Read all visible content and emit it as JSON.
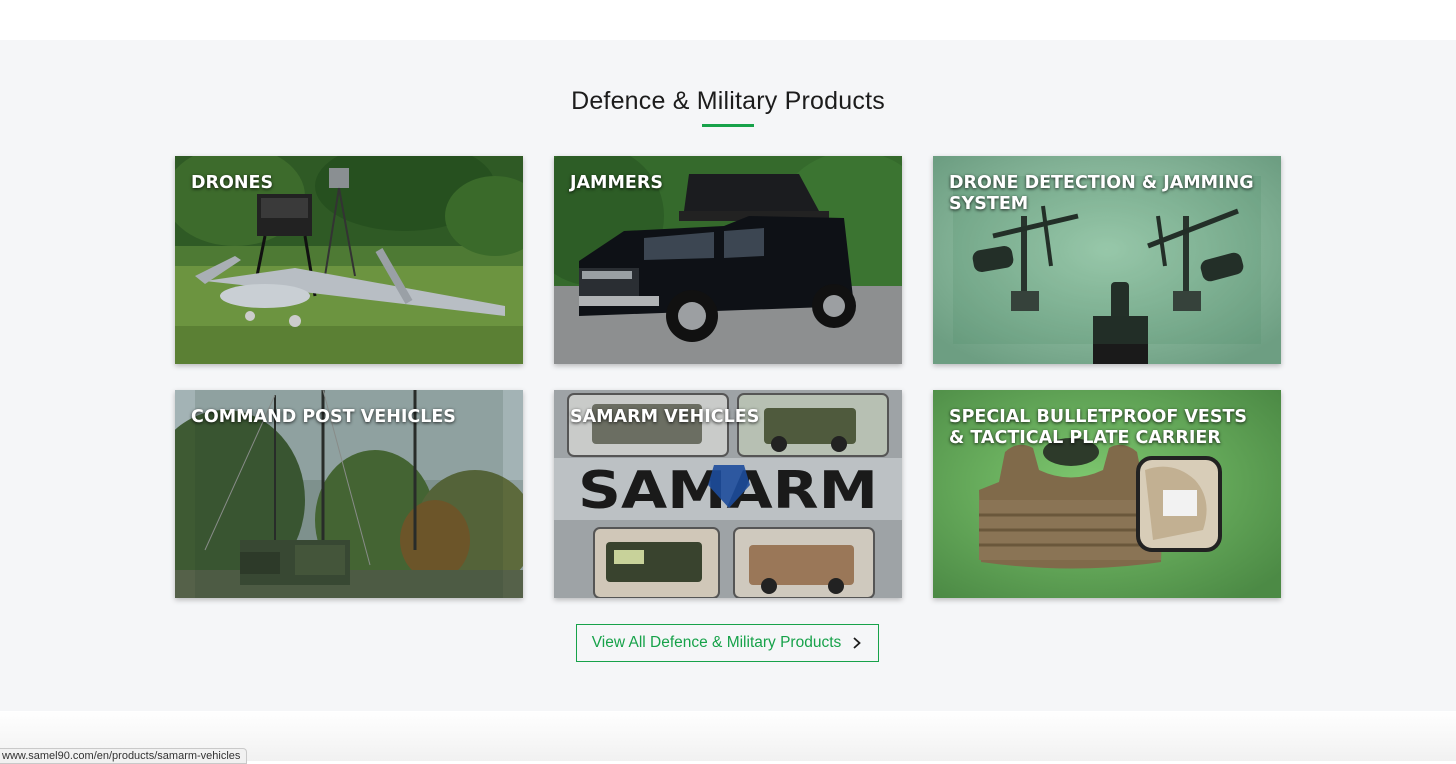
{
  "section": {
    "title": "Defence & Military Products"
  },
  "cards": [
    {
      "label": "DRONES"
    },
    {
      "label": "JAMMERS"
    },
    {
      "label": "DRONE DETECTION & JAMMING SYSTEM"
    },
    {
      "label": "COMMAND POST VEHICLES"
    },
    {
      "label": "SAMARM VEHICLES"
    },
    {
      "label": "SPECIAL BULLETPROOF VESTS & TACTICAL PLATE CARRIER"
    }
  ],
  "samarm_logo_text": "SAMARM",
  "view_all": {
    "label": "View All Defence & Military Products",
    "icon": "chevron-right-icon"
  },
  "status_bar": {
    "url": "www.samel90.com/en/products/samarm-vehicles"
  },
  "colors": {
    "accent": "#17a24a",
    "section_bg": "#f5f6f8"
  }
}
